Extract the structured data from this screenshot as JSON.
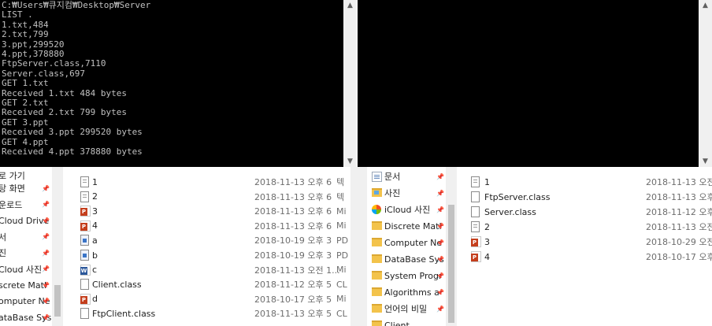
{
  "console_left": {
    "lines": [
      "C:₩Users₩큐지컴₩Desktop₩Server",
      "LIST .",
      "1.txt,484",
      "2.txt,799",
      "3.ppt,299520",
      "4.ppt,378880",
      "FtpServer.class,7110",
      "Server.class,697",
      "GET 1.txt",
      "Received 1.txt 484 bytes",
      "GET 2.txt",
      "Received 2.txt 799 bytes",
      "GET 3.ppt",
      "Received 3.ppt 299520 bytes",
      "GET 4.ppt",
      "Received 4.ppt 378880 bytes"
    ]
  },
  "console_scroll": {
    "up_arrow": "▲",
    "down_arrow": "▼"
  },
  "left_nav": {
    "items": [
      {
        "label": "로 가기",
        "icon": "quick-access-icon",
        "pinned": false
      },
      {
        "label": "탕 화면",
        "icon": "desktop-folder-icon",
        "pinned": true
      },
      {
        "label": "운로드",
        "icon": "downloads-folder-icon",
        "pinned": true
      },
      {
        "label": "Cloud Drive",
        "icon": "icloud-drive-icon",
        "pinned": true
      },
      {
        "label": "서",
        "icon": "documents-folder-icon",
        "pinned": true
      },
      {
        "label": "진",
        "icon": "pictures-folder-icon",
        "pinned": true
      },
      {
        "label": "Cloud 사진",
        "icon": "icloud-photos-icon",
        "pinned": true
      },
      {
        "label": "screte Matl",
        "icon": "folder-icon",
        "pinned": true
      },
      {
        "label": "omputer Ne",
        "icon": "folder-icon",
        "pinned": true
      },
      {
        "label": "ataBase Sys",
        "icon": "folder-icon",
        "pinned": true
      }
    ],
    "pin_glyph": "📌"
  },
  "left_files": [
    {
      "name": "1",
      "date": "2018-11-13 오후 6",
      "type": "텍",
      "icon": "text-file-icon"
    },
    {
      "name": "2",
      "date": "2018-11-13 오후 6",
      "type": "텍",
      "icon": "text-file-icon"
    },
    {
      "name": "3",
      "date": "2018-11-13 오후 6",
      "type": "Mi",
      "icon": "powerpoint-file-icon"
    },
    {
      "name": "4",
      "date": "2018-11-13 오후 6",
      "type": "Mi",
      "icon": "powerpoint-file-icon"
    },
    {
      "name": "a",
      "date": "2018-10-19 오후 3",
      "type": "PD",
      "icon": "pdf-file-icon"
    },
    {
      "name": "b",
      "date": "2018-10-19 오후 3",
      "type": "PD",
      "icon": "pdf-file-icon"
    },
    {
      "name": "c",
      "date": "2018-11-13 오전 1...",
      "type": "Mi",
      "icon": "word-file-icon"
    },
    {
      "name": "Client.class",
      "date": "2018-11-12 오후 5",
      "type": "CL",
      "icon": "class-file-icon"
    },
    {
      "name": "d",
      "date": "2018-10-17 오후 5",
      "type": "Mi",
      "icon": "powerpoint-file-icon"
    },
    {
      "name": "FtpClient.class",
      "date": "2018-11-13 오후 5",
      "type": "CL",
      "icon": "class-file-icon"
    }
  ],
  "right_nav": {
    "items": [
      {
        "label": "문서",
        "icon": "documents-folder-icon",
        "pinned": true
      },
      {
        "label": "사진",
        "icon": "pictures-folder-icon",
        "pinned": true
      },
      {
        "label": "iCloud 사진",
        "icon": "icloud-photos-icon",
        "pinned": true
      },
      {
        "label": "Discrete Matl",
        "icon": "folder-icon",
        "pinned": true
      },
      {
        "label": "Computer Ne",
        "icon": "folder-icon",
        "pinned": true
      },
      {
        "label": "DataBase Sys",
        "icon": "folder-icon",
        "pinned": true
      },
      {
        "label": "System Progr",
        "icon": "folder-icon",
        "pinned": true
      },
      {
        "label": "Algorithms a",
        "icon": "folder-icon",
        "pinned": true
      },
      {
        "label": "언어의 비밀",
        "icon": "folder-icon",
        "pinned": true
      },
      {
        "label": "Client",
        "icon": "folder-icon",
        "pinned": false
      }
    ],
    "pin_glyph": "📌"
  },
  "right_files": [
    {
      "name": "1",
      "date": "2018-11-13 오전",
      "icon": "text-file-icon"
    },
    {
      "name": "FtpServer.class",
      "date": "2018-11-13 오후",
      "icon": "class-file-icon"
    },
    {
      "name": "Server.class",
      "date": "2018-11-12 오후",
      "icon": "class-file-icon"
    },
    {
      "name": "2",
      "date": "2018-11-13 오전",
      "icon": "text-file-icon"
    },
    {
      "name": "3",
      "date": "2018-10-29 오전",
      "icon": "powerpoint-file-icon"
    },
    {
      "name": "4",
      "date": "2018-10-17 오후",
      "icon": "powerpoint-file-icon"
    }
  ]
}
